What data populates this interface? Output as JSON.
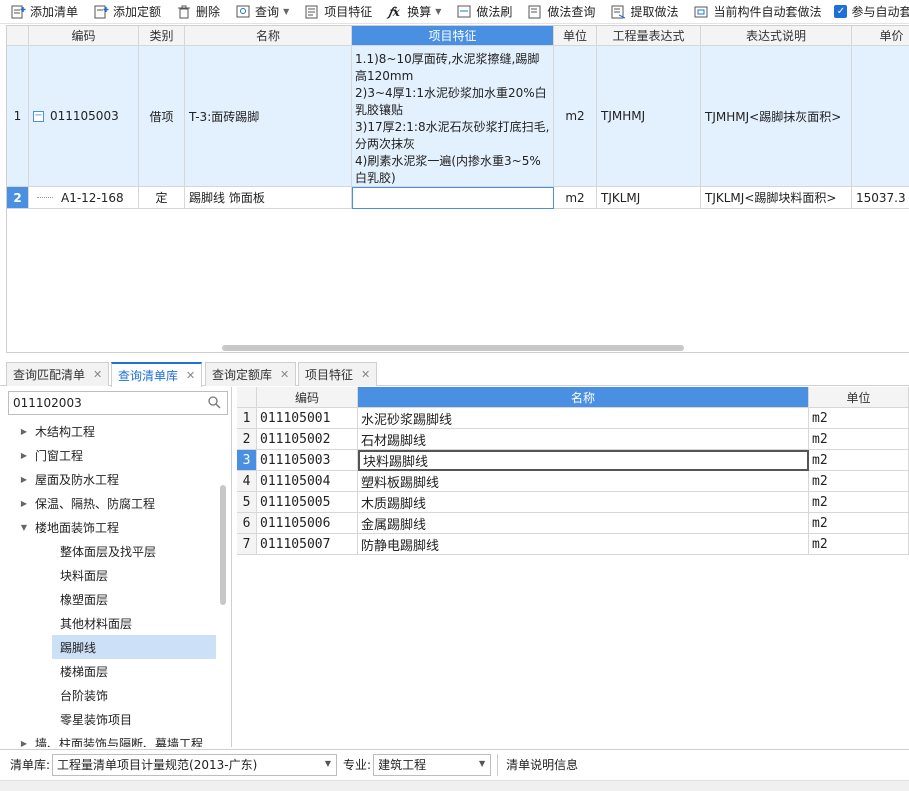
{
  "toolbar": {
    "add_bill": "添加清单",
    "add_quota": "添加定额",
    "delete": "删除",
    "query": "查询",
    "item_feature": "项目特征",
    "convert": "换算",
    "method_brush": "做法刷",
    "method_query": "做法查询",
    "extract_method": "提取做法",
    "auto_apply": "当前构件自动套做法",
    "participate_auto": "参与自动套"
  },
  "top_grid": {
    "headers": [
      "编码",
      "类别",
      "名称",
      "项目特征",
      "单位",
      "工程量表达式",
      "表达式说明",
      "单价"
    ],
    "rows": [
      {
        "num": "1",
        "code": "011105003",
        "type": "借项",
        "name": "T-3:面砖踢脚",
        "feature": "1.1)8~10厚面砖,水泥浆擦缝,踢脚高120mm\n2)3~4厚1:1水泥砂浆加水重20%白乳胶镶贴\n3)17厚2:1:8水泥石灰砂浆打底扫毛,分两次抹灰\n4)刷素水泥浆一遍(内掺水重3~5%白乳胶)",
        "unit": "m2",
        "expr": "TJMHMJ",
        "expr_desc": "TJMHMJ<踢脚抹灰面积>",
        "price": ""
      },
      {
        "num": "2",
        "code": "A1-12-168",
        "type": "定",
        "name": "踢脚线 饰面板",
        "feature": "",
        "unit": "m2",
        "expr": "TJKLMJ",
        "expr_desc": "TJKLMJ<踢脚块料面积>",
        "price": "15037.3"
      }
    ]
  },
  "tabs": [
    "查询匹配清单",
    "查询清单库",
    "查询定额库",
    "项目特征"
  ],
  "search": {
    "value": "011102003"
  },
  "tree": [
    {
      "label": "木结构工程",
      "level": 0,
      "arrow": "right"
    },
    {
      "label": "门窗工程",
      "level": 0,
      "arrow": "right"
    },
    {
      "label": "屋面及防水工程",
      "level": 0,
      "arrow": "right"
    },
    {
      "label": "保温、隔热、防腐工程",
      "level": 0,
      "arrow": "right"
    },
    {
      "label": "楼地面装饰工程",
      "level": 0,
      "arrow": "down"
    },
    {
      "label": "整体面层及找平层",
      "level": 1
    },
    {
      "label": "块料面层",
      "level": 1
    },
    {
      "label": "橡塑面层",
      "level": 1
    },
    {
      "label": "其他材料面层",
      "level": 1
    },
    {
      "label": "踢脚线",
      "level": 1,
      "selected": true
    },
    {
      "label": "楼梯面层",
      "level": 1
    },
    {
      "label": "台阶装饰",
      "level": 1
    },
    {
      "label": "零星装饰项目",
      "level": 1
    },
    {
      "label": "墙、柱面装饰与隔断、幕墙工程",
      "level": 0,
      "arrow": "right"
    }
  ],
  "result_table": {
    "headers": [
      "编码",
      "名称",
      "单位"
    ],
    "rows": [
      {
        "num": "1",
        "code": "011105001",
        "name": "水泥砂浆踢脚线",
        "unit": "m2"
      },
      {
        "num": "2",
        "code": "011105002",
        "name": "石材踢脚线",
        "unit": "m2"
      },
      {
        "num": "3",
        "code": "011105003",
        "name": "块料踢脚线",
        "unit": "m2"
      },
      {
        "num": "4",
        "code": "011105004",
        "name": "塑料板踢脚线",
        "unit": "m2"
      },
      {
        "num": "5",
        "code": "011105005",
        "name": "木质踢脚线",
        "unit": "m2"
      },
      {
        "num": "6",
        "code": "011105006",
        "name": "金属踢脚线",
        "unit": "m2"
      },
      {
        "num": "7",
        "code": "011105007",
        "name": "防静电踢脚线",
        "unit": "m2"
      }
    ]
  },
  "footer": {
    "lib_label": "清单库:",
    "lib_value": "工程量清单项目计量规范(2013-广东)",
    "major_label": "专业:",
    "major_value": "建筑工程",
    "desc_label": "清单说明信息"
  },
  "colors": {
    "accent": "#4a90e2",
    "selected_row": "#e3f0fd",
    "tree_selected": "#cce0f7"
  }
}
